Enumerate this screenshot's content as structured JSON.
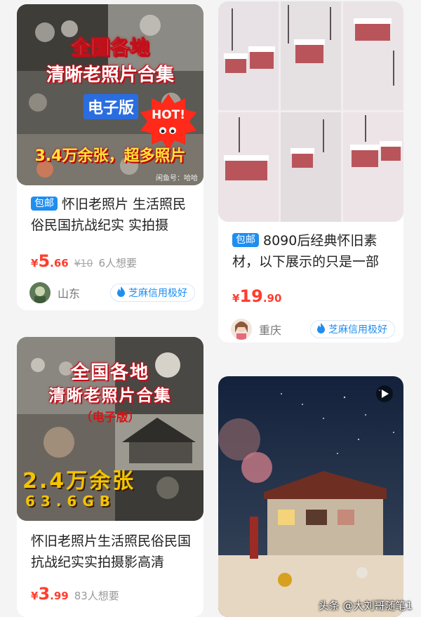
{
  "products": [
    {
      "image_lines": [
        "全国各地",
        "清晰老照片合集",
        "电子版",
        "3.4万余张，超多照片"
      ],
      "hot_badge": "HOT!",
      "image_corner": "闲鱼号：哈哈",
      "badge": "包邮",
      "title": "怀旧老照片 生活照民俗民国抗战纪实 实拍摄",
      "price": {
        "currency": "¥",
        "int": "5",
        "dec": ".66"
      },
      "original_price": "¥10",
      "want": "6人想要",
      "location": "山东",
      "credit": "芝麻信用极好"
    },
    {
      "badge": "包邮",
      "title": "8090后经典怀旧素材，以下展示的只是一部",
      "price": {
        "currency": "¥",
        "int": "19",
        "dec": ".90"
      },
      "location": "重庆",
      "credit": "芝麻信用极好"
    },
    {
      "image_lines": [
        "全国各地",
        "清晰老照片合集",
        "（电子版）",
        "2.4万余张",
        "63.6GB"
      ],
      "title": "怀旧老照片生活照民俗民国抗战纪实实拍摄影高清",
      "price": {
        "currency": "¥",
        "int": "3",
        "dec": ".99"
      },
      "want": "83人想要"
    },
    {
      "description": "winter village illustration"
    }
  ],
  "watermark": "头条 @大刘哥随笔1",
  "colors": {
    "price": "#ff3d2e",
    "badge": "#1f8ef1",
    "credit": "#1f8ef1",
    "background": "#f4f4f4"
  }
}
